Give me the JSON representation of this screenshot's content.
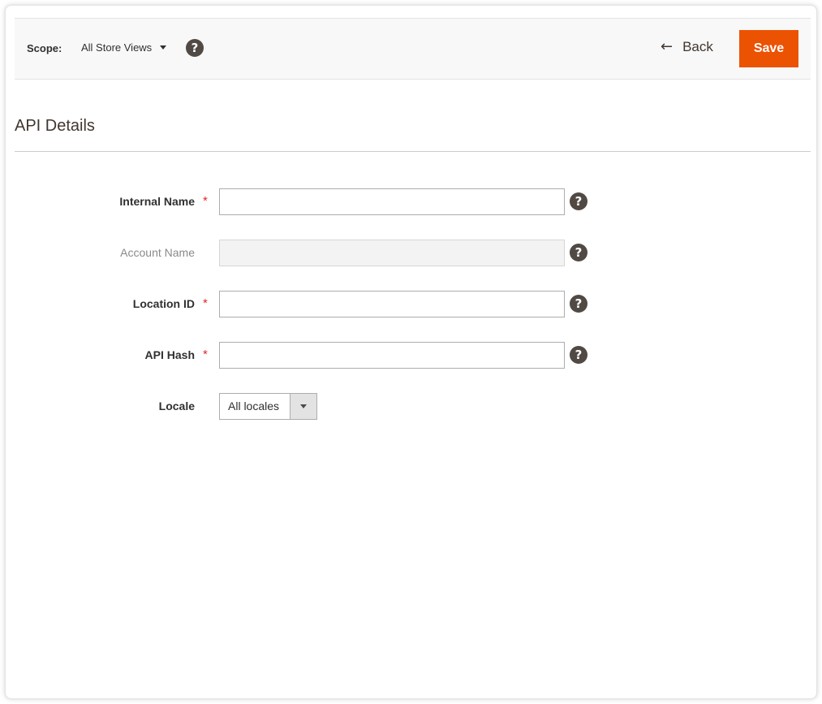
{
  "toolbar": {
    "scope_label": "Scope:",
    "scope_value": "All Store Views",
    "help_glyph": "?",
    "back_label": "Back",
    "back_icon": "arrow-left-icon",
    "save_label": "Save"
  },
  "section": {
    "title": "API Details"
  },
  "form": {
    "fields": [
      {
        "label": "Internal Name",
        "required": true,
        "value": "",
        "disabled": false
      },
      {
        "label": "Account Name",
        "required": false,
        "value": "",
        "disabled": true
      },
      {
        "label": "Location ID",
        "required": true,
        "value": "",
        "disabled": false
      },
      {
        "label": "API Hash",
        "required": true,
        "value": "",
        "disabled": false
      }
    ],
    "locale": {
      "label": "Locale",
      "selected": "All locales"
    },
    "required_marker": "*"
  },
  "colors": {
    "accent": "#eb5202",
    "help_icon": "#514943",
    "required": "#e22626"
  }
}
